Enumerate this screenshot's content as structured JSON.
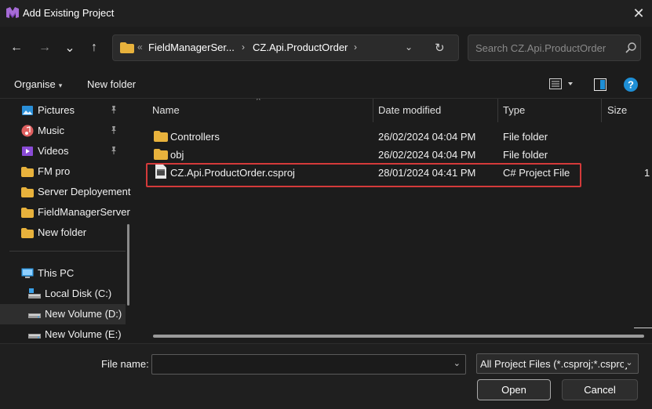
{
  "window": {
    "title": "Add Existing Project",
    "close_glyph": "✕"
  },
  "nav": {
    "back_glyph": "←",
    "forward_glyph": "→",
    "recent_glyph": "⌄",
    "up_glyph": "↑",
    "breadcrumb_overflow": "«",
    "breadcrumb": [
      "FieldManagerSer...",
      "CZ.Api.ProductOrder"
    ],
    "breadcrumb_sep": "›",
    "address_dropdown_glyph": "⌄",
    "refresh_glyph": "↻"
  },
  "search": {
    "placeholder": "Search CZ.Api.ProductOrder"
  },
  "toolbar": {
    "organise": "Organise",
    "organise_caret": "▾",
    "new_folder": "New folder",
    "view_caret": "▾",
    "help_glyph": "?"
  },
  "sidebar": {
    "items": [
      {
        "label": "Pictures",
        "icon": "pictures-icon",
        "pinned": true
      },
      {
        "label": "Music",
        "icon": "music-icon",
        "pinned": true
      },
      {
        "label": "Videos",
        "icon": "videos-icon",
        "pinned": true
      },
      {
        "label": "FM pro",
        "icon": "folder-icon",
        "pinned": false
      },
      {
        "label": "Server Deployement",
        "icon": "folder-icon",
        "pinned": false
      },
      {
        "label": "FieldManagerServer",
        "icon": "folder-icon",
        "pinned": false
      },
      {
        "label": "New folder",
        "icon": "folder-icon",
        "pinned": false
      },
      {
        "label": "This PC",
        "icon": "this-pc-icon",
        "pinned": false
      },
      {
        "label": "Local Disk (C:)",
        "icon": "local-disk-icon",
        "pinned": false
      },
      {
        "label": "New Volume (D:)",
        "icon": "drive-icon",
        "pinned": false,
        "selected": true
      },
      {
        "label": "New Volume (E:)",
        "icon": "drive-icon",
        "pinned": false
      }
    ]
  },
  "file_list": {
    "sort_glyph": "^",
    "columns": {
      "name": "Name",
      "date": "Date modified",
      "type": "Type",
      "size": "Size"
    },
    "rows": [
      {
        "name": "Controllers",
        "date": "26/02/2024 04:04 PM",
        "type": "File folder",
        "size": "",
        "icon": "folder-icon"
      },
      {
        "name": "obj",
        "date": "26/02/2024 04:04 PM",
        "type": "File folder",
        "size": "",
        "icon": "folder-icon"
      },
      {
        "name": "CZ.Api.ProductOrder.csproj",
        "date": "28/01/2024 04:41 PM",
        "type": "C# Project File",
        "size": "1",
        "icon": "csproj-file-icon",
        "highlighted": true
      }
    ]
  },
  "footer": {
    "file_name_label": "File name:",
    "file_name_value": "",
    "file_name_dropdown_glyph": "⌄",
    "filter": "All Project Files (*.csproj;*.csproj",
    "filter_dropdown_glyph": "⌄",
    "open": "Open",
    "cancel": "Cancel"
  },
  "colors": {
    "accent_blue": "#1e8fd6",
    "highlight_red": "#d43a3a",
    "folder_yellow": "#e8b23c"
  }
}
